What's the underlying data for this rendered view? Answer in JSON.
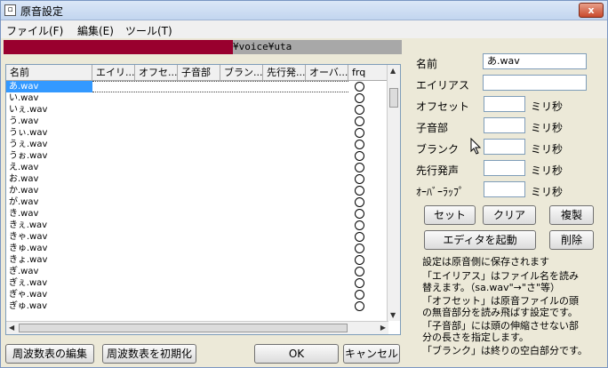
{
  "window": {
    "title": "原音設定",
    "close_label": "x"
  },
  "menu": [
    "ファイル(F)",
    "編集(E)",
    "ツール(T)"
  ],
  "path": {
    "text": "¥voice¥uta"
  },
  "table": {
    "headers": [
      "名前",
      "エイリ...",
      "オフセ...",
      "子音部",
      "ブラン...",
      "先行発...",
      "オーバ...",
      "frq"
    ],
    "rows": [
      "あ.wav",
      "い.wav",
      "いぇ.wav",
      "う.wav",
      "うぃ.wav",
      "うぇ.wav",
      "うぉ.wav",
      "え.wav",
      "お.wav",
      "か.wav",
      "が.wav",
      "き.wav",
      "きぇ.wav",
      "きゃ.wav",
      "きゅ.wav",
      "きょ.wav",
      "ぎ.wav",
      "ぎぇ.wav",
      "ぎゃ.wav",
      "ぎゅ.wav"
    ],
    "selected_index": 0
  },
  "form": {
    "name_label": "名前",
    "name_value": "あ.wav",
    "alias_label": "エイリアス",
    "alias_value": "",
    "offset_label": "オフセット",
    "consonant_label": "子音部",
    "blank_label": "ブランク",
    "preutter_label": "先行発声",
    "overlap_label": "ｵｰﾊﾞｰﾗｯﾌﾟ",
    "unit": "ミリ秒"
  },
  "buttons": {
    "set": "セット",
    "clear": "クリア",
    "copy": "複製",
    "editor": "エディタを起動",
    "delete": "削除",
    "edit_freq": "周波数表の編集",
    "init_freq": "周波数表を初期化",
    "ok": "OK",
    "cancel": "キャンセル"
  },
  "notes": [
    "設定は原音側に保存されます",
    "「エイリアス」はファイル名を読み",
    "替えます。（sa.wav\"→\"さ\"等）",
    "「オフセット」は原音ファイルの頭",
    "の無音部分を読み飛ばす設定です。",
    "「子音部」には頭の伸縮させない部",
    "分の長さを指定します。",
    "「ブランク」は終りの空白部分です。"
  ]
}
